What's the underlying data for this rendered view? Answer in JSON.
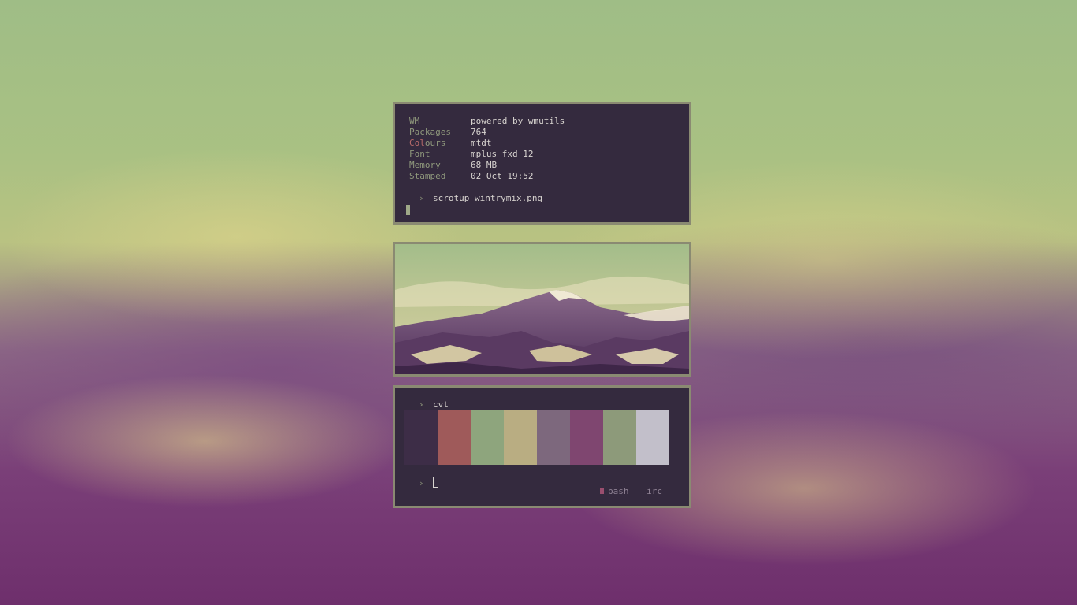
{
  "info": {
    "rows": [
      {
        "key": "WM",
        "value": "powered by wmutils"
      },
      {
        "key": "Packages",
        "value": "764"
      },
      {
        "key_prefix": "Col",
        "key_suffix": "ours",
        "value": "mtdt"
      },
      {
        "key": "Font",
        "value": "mplus fxd 12"
      },
      {
        "key": "Memory",
        "value": "68 MB"
      },
      {
        "key": "Stamped",
        "value": "02 Oct 19:52"
      }
    ],
    "prompt_symbol": "›",
    "command": "scrotup wintrymix.png"
  },
  "image": {
    "icon": "mountain-landscape-icon"
  },
  "terminal": {
    "prompt_symbol": "›",
    "command": "cvt",
    "palette": [
      "#3d2d47",
      "#9f5a5a",
      "#8ea57d",
      "#b9ad82",
      "#7d687d",
      "#7f4670",
      "#8d9a7a",
      "#c2bfca"
    ],
    "tabs": [
      {
        "label": "bash",
        "active": true
      },
      {
        "label": "irc",
        "active": false
      }
    ]
  }
}
